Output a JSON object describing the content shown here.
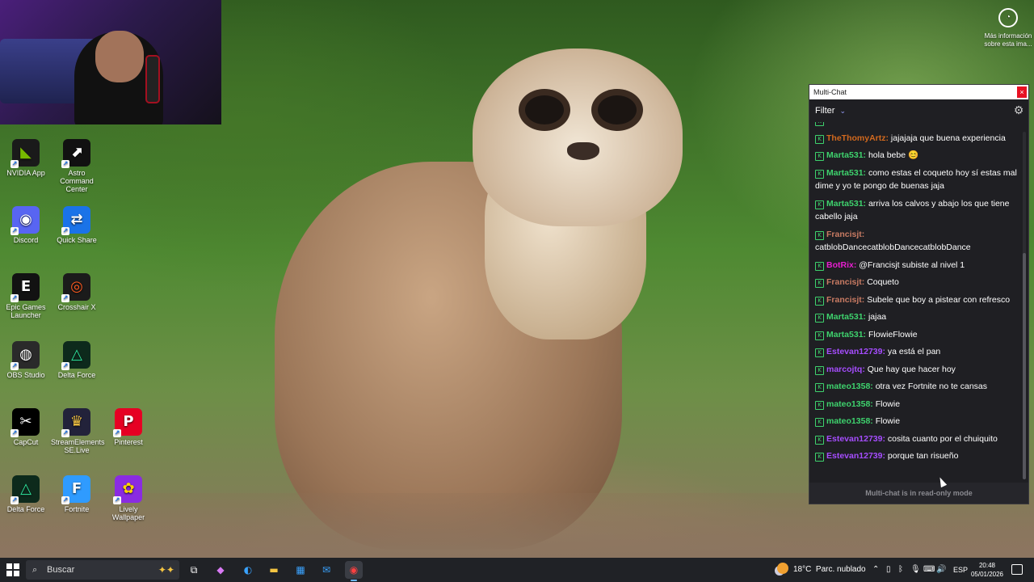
{
  "wallpaper_info": {
    "text": "Más información sobre esta ima..."
  },
  "desktop_icons": [
    {
      "label": "NVIDIA App",
      "color": "#1a1a1a",
      "glyph": "◣",
      "fg": "#76b900"
    },
    {
      "label": "Astro Command Center",
      "color": "#111111",
      "glyph": "⬈",
      "fg": "#ffffff"
    },
    {
      "label": "Discord",
      "color": "#5865f2",
      "glyph": "◉",
      "fg": "#ffffff"
    },
    {
      "label": "Quick Share",
      "color": "#1a73e8",
      "glyph": "⇄",
      "fg": "#ffffff"
    },
    {
      "label": "Epic Games Launcher",
      "color": "#121212",
      "glyph": "E",
      "fg": "#ffffff"
    },
    {
      "label": "Crosshair X",
      "color": "#1b1b1b",
      "glyph": "◎",
      "fg": "#ff5a1f"
    },
    {
      "label": "OBS Studio",
      "color": "#2a2a2a",
      "glyph": "◍",
      "fg": "#ffffff"
    },
    {
      "label": "Delta Force",
      "color": "#0d2a1c",
      "glyph": "△",
      "fg": "#2ee59d"
    },
    {
      "label": "CapCut",
      "color": "#000000",
      "glyph": "✂",
      "fg": "#ffffff"
    },
    {
      "label": "StreamElements SE.Live",
      "color": "#22223a",
      "glyph": "♛",
      "fg": "#f5c542"
    },
    {
      "label": "Pinterest",
      "color": "#e60023",
      "glyph": "P",
      "fg": "#ffffff"
    },
    {
      "label": "Delta Force",
      "color": "#0d2a1c",
      "glyph": "△",
      "fg": "#2ee59d"
    },
    {
      "label": "Fortnite",
      "color": "#2f9bff",
      "glyph": "F",
      "fg": "#ffffff"
    },
    {
      "label": "Lively Wallpaper",
      "color": "#8a2be2",
      "glyph": "✿",
      "fg": "#ffd400"
    }
  ],
  "chat": {
    "title": "Multi-Chat",
    "close": "×",
    "filter_label": "Filter",
    "footer": "Multi-chat is in read-only mode",
    "messages": [
      {
        "user": "",
        "text": "",
        "color": "#3ed26d"
      },
      {
        "user": "TheThomyArtz:",
        "text": "jajajaja que buena experiencia",
        "color": "#d2691e"
      },
      {
        "user": "Marta531:",
        "text": "hola bebe 😊",
        "color": "#3ed26d"
      },
      {
        "user": "Marta531:",
        "text": "como estas el coqueto hoy sí estas mal dime y yo te pongo de buenas jaja",
        "color": "#3ed26d"
      },
      {
        "user": "Marta531:",
        "text": "arriva los calvos y abajo los que tiene cabello jaja",
        "color": "#3ed26d"
      },
      {
        "user": "Francisjt:",
        "text": "catblobDancecatblobDancecatblobDance",
        "color": "#c97b63"
      },
      {
        "user": "BotRix:",
        "text": "@Francisjt subiste al nivel 1",
        "color": "#e61ecf"
      },
      {
        "user": "Francisjt:",
        "text": "Coqueto",
        "color": "#c97b63"
      },
      {
        "user": "Francisjt:",
        "text": "Subele que boy a pistear con refresco",
        "color": "#c97b63"
      },
      {
        "user": "Marta531:",
        "text": "jajaa",
        "color": "#3ed26d"
      },
      {
        "user": "Marta531:",
        "text": "FlowieFlowie",
        "color": "#3ed26d"
      },
      {
        "user": "Estevan12739:",
        "text": "ya está el pan",
        "color": "#a64dff"
      },
      {
        "user": "marcojtq:",
        "text": "Que hay que hacer hoy",
        "color": "#a64dff"
      },
      {
        "user": "mateo1358:",
        "text": "otra vez Fortnite no te cansas",
        "color": "#3ed26d"
      },
      {
        "user": "mateo1358:",
        "text": "Flowie",
        "color": "#3ed26d"
      },
      {
        "user": "mateo1358:",
        "text": "Flowie",
        "color": "#3ed26d"
      },
      {
        "user": "Estevan12739:",
        "text": "cosita cuanto por el chuiquito",
        "color": "#a64dff"
      },
      {
        "user": "Estevan12739:",
        "text": "porque tan risueño",
        "color": "#a64dff"
      }
    ]
  },
  "taskbar": {
    "search_placeholder": "Buscar",
    "weather_temp": "18°C",
    "weather_text": "Parc. nublado",
    "language": "ESP",
    "time": "20:48",
    "date": "05/01/2026"
  }
}
